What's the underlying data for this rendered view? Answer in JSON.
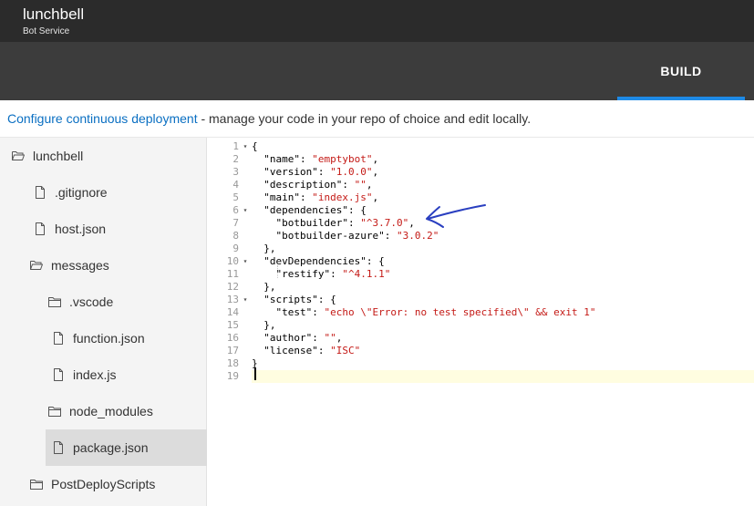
{
  "header": {
    "title": "lunchbell",
    "subtitle": "Bot Service"
  },
  "tabs": [
    {
      "label": "BUILD",
      "active": true
    }
  ],
  "banner": {
    "link_text": "Configure continuous deployment",
    "text": " - manage your code in your repo of choice and edit locally."
  },
  "sidebar": {
    "items": [
      {
        "label": "lunchbell",
        "icon": "folder-open-icon"
      },
      {
        "label": ".gitignore",
        "icon": "file-icon"
      },
      {
        "label": "host.json",
        "icon": "file-icon"
      },
      {
        "label": "messages",
        "icon": "folder-open-icon"
      },
      {
        "label": ".vscode",
        "icon": "folder-icon"
      },
      {
        "label": "function.json",
        "icon": "file-icon"
      },
      {
        "label": "index.js",
        "icon": "file-icon"
      },
      {
        "label": "node_modules",
        "icon": "folder-icon"
      },
      {
        "label": "package.json",
        "icon": "file-icon",
        "selected": true
      },
      {
        "label": "PostDeployScripts",
        "icon": "folder-icon"
      }
    ]
  },
  "editor": {
    "file_name": "package.json",
    "lines": [
      "{",
      "  \"name\": \"emptybot\",",
      "  \"version\": \"1.0.0\",",
      "  \"description\": \"\",",
      "  \"main\": \"index.js\",",
      "  \"dependencies\": {",
      "    \"botbuilder\": \"^3.7.0\",",
      "    \"botbuilder-azure\": \"3.0.2\"",
      "  },",
      "  \"devDependencies\": {",
      "    \"restify\": \"^4.1.1\"",
      "  },",
      "  \"scripts\": {",
      "    \"test\": \"echo \\\"Error: no test specified\\\" && exit 1\"",
      "  },",
      "  \"author\": \"\",",
      "  \"license\": \"ISC\"",
      "}",
      ""
    ],
    "fold_lines": [
      1,
      6,
      10,
      13
    ],
    "active_line": 19
  },
  "colors": {
    "topbar": "#2b2b2b",
    "tabbar": "#3c3c3c",
    "tab_underline": "#1e8ae6",
    "link": "#0a6fc2",
    "string": "#c41a16",
    "arrow": "#2a3fc0"
  }
}
